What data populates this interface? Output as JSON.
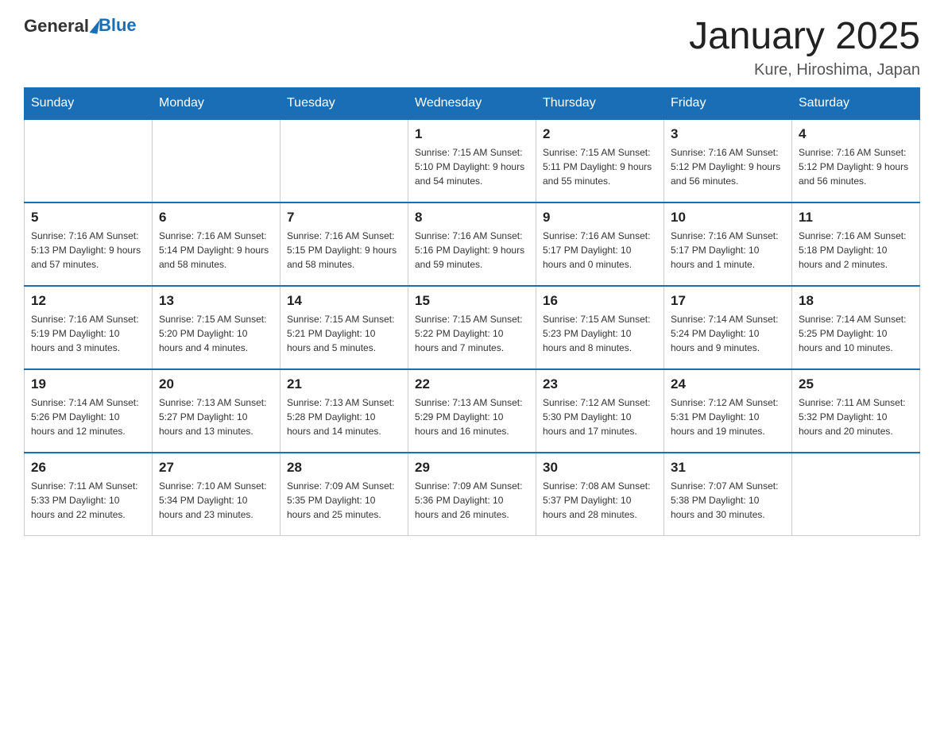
{
  "header": {
    "logo_general": "General",
    "logo_blue": "Blue",
    "month_title": "January 2025",
    "location": "Kure, Hiroshima, Japan"
  },
  "days_of_week": [
    "Sunday",
    "Monday",
    "Tuesday",
    "Wednesday",
    "Thursday",
    "Friday",
    "Saturday"
  ],
  "weeks": [
    [
      {
        "day": "",
        "info": ""
      },
      {
        "day": "",
        "info": ""
      },
      {
        "day": "",
        "info": ""
      },
      {
        "day": "1",
        "info": "Sunrise: 7:15 AM\nSunset: 5:10 PM\nDaylight: 9 hours\nand 54 minutes."
      },
      {
        "day": "2",
        "info": "Sunrise: 7:15 AM\nSunset: 5:11 PM\nDaylight: 9 hours\nand 55 minutes."
      },
      {
        "day": "3",
        "info": "Sunrise: 7:16 AM\nSunset: 5:12 PM\nDaylight: 9 hours\nand 56 minutes."
      },
      {
        "day": "4",
        "info": "Sunrise: 7:16 AM\nSunset: 5:12 PM\nDaylight: 9 hours\nand 56 minutes."
      }
    ],
    [
      {
        "day": "5",
        "info": "Sunrise: 7:16 AM\nSunset: 5:13 PM\nDaylight: 9 hours\nand 57 minutes."
      },
      {
        "day": "6",
        "info": "Sunrise: 7:16 AM\nSunset: 5:14 PM\nDaylight: 9 hours\nand 58 minutes."
      },
      {
        "day": "7",
        "info": "Sunrise: 7:16 AM\nSunset: 5:15 PM\nDaylight: 9 hours\nand 58 minutes."
      },
      {
        "day": "8",
        "info": "Sunrise: 7:16 AM\nSunset: 5:16 PM\nDaylight: 9 hours\nand 59 minutes."
      },
      {
        "day": "9",
        "info": "Sunrise: 7:16 AM\nSunset: 5:17 PM\nDaylight: 10 hours\nand 0 minutes."
      },
      {
        "day": "10",
        "info": "Sunrise: 7:16 AM\nSunset: 5:17 PM\nDaylight: 10 hours\nand 1 minute."
      },
      {
        "day": "11",
        "info": "Sunrise: 7:16 AM\nSunset: 5:18 PM\nDaylight: 10 hours\nand 2 minutes."
      }
    ],
    [
      {
        "day": "12",
        "info": "Sunrise: 7:16 AM\nSunset: 5:19 PM\nDaylight: 10 hours\nand 3 minutes."
      },
      {
        "day": "13",
        "info": "Sunrise: 7:15 AM\nSunset: 5:20 PM\nDaylight: 10 hours\nand 4 minutes."
      },
      {
        "day": "14",
        "info": "Sunrise: 7:15 AM\nSunset: 5:21 PM\nDaylight: 10 hours\nand 5 minutes."
      },
      {
        "day": "15",
        "info": "Sunrise: 7:15 AM\nSunset: 5:22 PM\nDaylight: 10 hours\nand 7 minutes."
      },
      {
        "day": "16",
        "info": "Sunrise: 7:15 AM\nSunset: 5:23 PM\nDaylight: 10 hours\nand 8 minutes."
      },
      {
        "day": "17",
        "info": "Sunrise: 7:14 AM\nSunset: 5:24 PM\nDaylight: 10 hours\nand 9 minutes."
      },
      {
        "day": "18",
        "info": "Sunrise: 7:14 AM\nSunset: 5:25 PM\nDaylight: 10 hours\nand 10 minutes."
      }
    ],
    [
      {
        "day": "19",
        "info": "Sunrise: 7:14 AM\nSunset: 5:26 PM\nDaylight: 10 hours\nand 12 minutes."
      },
      {
        "day": "20",
        "info": "Sunrise: 7:13 AM\nSunset: 5:27 PM\nDaylight: 10 hours\nand 13 minutes."
      },
      {
        "day": "21",
        "info": "Sunrise: 7:13 AM\nSunset: 5:28 PM\nDaylight: 10 hours\nand 14 minutes."
      },
      {
        "day": "22",
        "info": "Sunrise: 7:13 AM\nSunset: 5:29 PM\nDaylight: 10 hours\nand 16 minutes."
      },
      {
        "day": "23",
        "info": "Sunrise: 7:12 AM\nSunset: 5:30 PM\nDaylight: 10 hours\nand 17 minutes."
      },
      {
        "day": "24",
        "info": "Sunrise: 7:12 AM\nSunset: 5:31 PM\nDaylight: 10 hours\nand 19 minutes."
      },
      {
        "day": "25",
        "info": "Sunrise: 7:11 AM\nSunset: 5:32 PM\nDaylight: 10 hours\nand 20 minutes."
      }
    ],
    [
      {
        "day": "26",
        "info": "Sunrise: 7:11 AM\nSunset: 5:33 PM\nDaylight: 10 hours\nand 22 minutes."
      },
      {
        "day": "27",
        "info": "Sunrise: 7:10 AM\nSunset: 5:34 PM\nDaylight: 10 hours\nand 23 minutes."
      },
      {
        "day": "28",
        "info": "Sunrise: 7:09 AM\nSunset: 5:35 PM\nDaylight: 10 hours\nand 25 minutes."
      },
      {
        "day": "29",
        "info": "Sunrise: 7:09 AM\nSunset: 5:36 PM\nDaylight: 10 hours\nand 26 minutes."
      },
      {
        "day": "30",
        "info": "Sunrise: 7:08 AM\nSunset: 5:37 PM\nDaylight: 10 hours\nand 28 minutes."
      },
      {
        "day": "31",
        "info": "Sunrise: 7:07 AM\nSunset: 5:38 PM\nDaylight: 10 hours\nand 30 minutes."
      },
      {
        "day": "",
        "info": ""
      }
    ]
  ]
}
